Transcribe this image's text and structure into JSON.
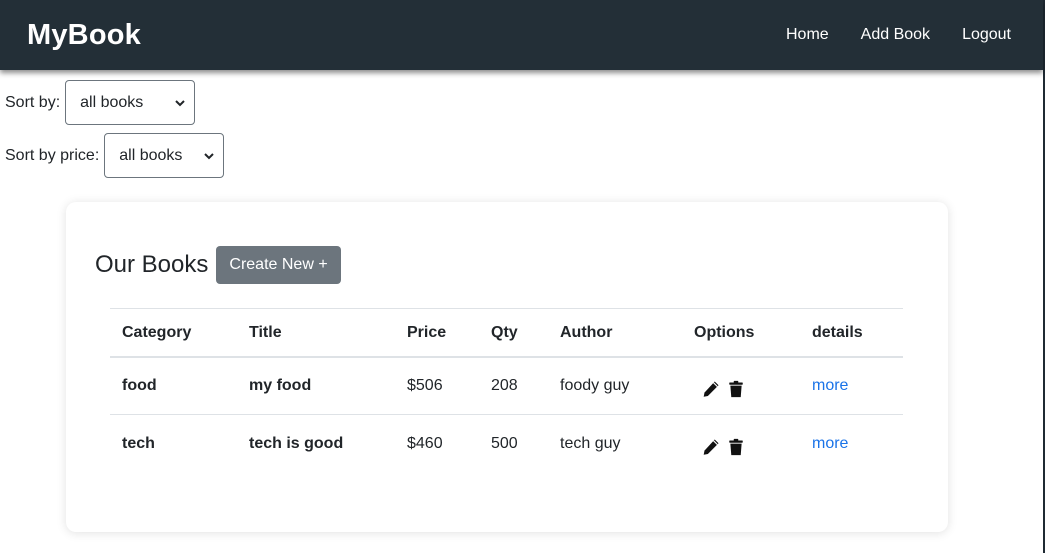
{
  "navbar": {
    "brand": "MyBook",
    "links": [
      "Home",
      "Add Book",
      "Logout"
    ]
  },
  "filters": {
    "sort_by": {
      "label": "Sort by:",
      "selected": "all books"
    },
    "sort_by_price": {
      "label": "Sort by price:",
      "selected": "all books"
    }
  },
  "card": {
    "title": "Our Books",
    "create_button": "Create New +"
  },
  "table": {
    "headers": [
      "Category",
      "Title",
      "Price",
      "Qty",
      "Author",
      "Options",
      "details"
    ],
    "rows": [
      {
        "category": "food",
        "title": "my food",
        "price": "$506",
        "qty": "208",
        "author": "foody guy",
        "details": "more"
      },
      {
        "category": "tech",
        "title": "tech is good",
        "price": "$460",
        "qty": "500",
        "author": "tech guy",
        "details": "more"
      }
    ]
  },
  "icons": {
    "edit": "pencil-icon",
    "delete": "trash-icon",
    "select": "chevron-down-icon"
  },
  "colors": {
    "navbar": "#232f37",
    "button": "#6c757d",
    "link": "#1a73e8"
  }
}
